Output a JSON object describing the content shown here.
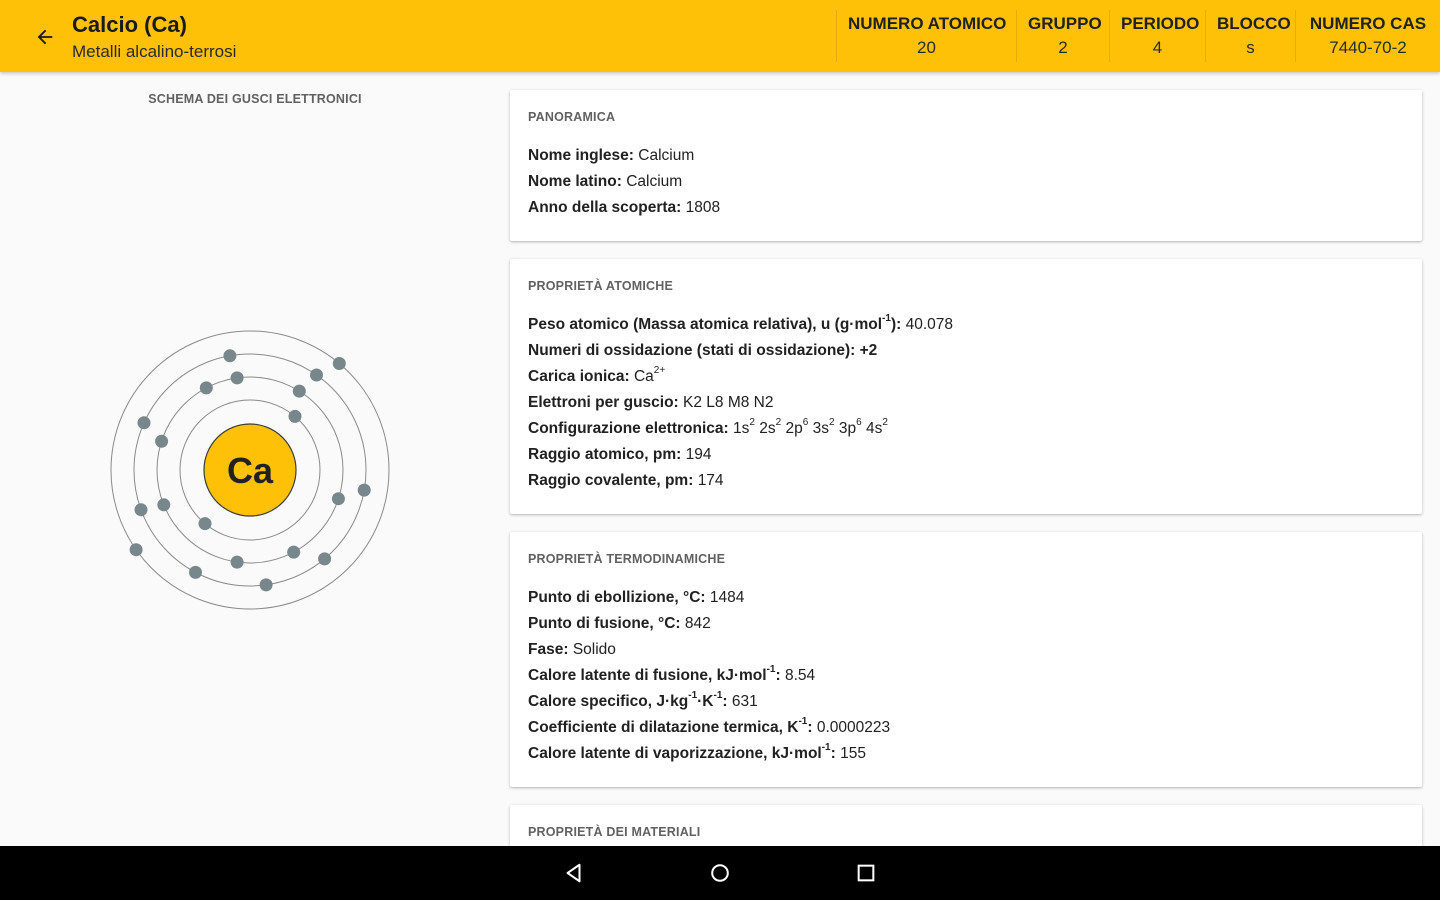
{
  "header": {
    "title": "Calcio (Ca)",
    "subtitle": "Metalli alcalino-terrosi",
    "stats": [
      {
        "label": "NUMERO ATOMICO",
        "value": "20"
      },
      {
        "label": "GRUPPO",
        "value": "2"
      },
      {
        "label": "PERIODO",
        "value": "4"
      },
      {
        "label": "BLOCCO",
        "value": "s"
      },
      {
        "label": "NUMERO CAS",
        "value": "7440-70-2"
      }
    ]
  },
  "shell_diagram": {
    "heading": "SCHEMA DEI GUSCI ELETTRONICI",
    "symbol": "Ca",
    "core_color": "#ffc107",
    "electron_color": "#78878c"
  },
  "overview": {
    "title": "PANORAMICA",
    "english_name_label": "Nome inglese:",
    "english_name": "Calcium",
    "latin_name_label": "Nome latino:",
    "latin_name": "Calcium",
    "discovery_label": "Anno della scoperta:",
    "discovery": "1808"
  },
  "atomic": {
    "title": "PROPRIETÀ ATOMICHE",
    "weight_label": "Peso atomico (Massa atomica relativa), u (g·mol",
    "weight_unit_sup": "-1",
    "weight_label_end": "):",
    "weight": "40.078",
    "oxidation_label": "Numeri di ossidazione (stati di ossidazione):",
    "oxidation": "+2",
    "ionic_label": "Carica ionica:",
    "ionic": "Ca",
    "ionic_sup": "2+",
    "shells_label": "Elettroni per guscio:",
    "shells": "K2 L8 M8 N2",
    "config_label": "Configurazione elettronica:",
    "config": [
      {
        "orb": "1s",
        "n": "2"
      },
      {
        "orb": "2s",
        "n": "2"
      },
      {
        "orb": "2p",
        "n": "6"
      },
      {
        "orb": "3s",
        "n": "2"
      },
      {
        "orb": "3p",
        "n": "6"
      },
      {
        "orb": "4s",
        "n": "2"
      }
    ],
    "radius_label": "Raggio atomico, pm:",
    "radius": "194",
    "covalent_label": "Raggio covalente, pm:",
    "covalent": "174"
  },
  "thermo": {
    "title": "PROPRIETÀ TERMODINAMICHE",
    "boiling_label": "Punto di ebollizione, °C:",
    "boiling": "1484",
    "melting_label": "Punto di fusione, °C:",
    "melting": "842",
    "phase_label": "Fase:",
    "phase": "Solido",
    "fusion_label": "Calore latente di fusione, kJ·mol",
    "fusion_sup": "-1",
    "fusion": "8.54",
    "specific_label_a": "Calore specifico, J·kg",
    "specific_sup_a": "-1",
    "specific_label_b": "·K",
    "specific_sup_b": "-1",
    "specific": "631",
    "expansion_label": "Coefficiente di dilatazione termica, K",
    "expansion_sup": "-1",
    "expansion": "0.0000223",
    "vapor_label": "Calore latente di vaporizzazione, kJ·mol",
    "vapor_sup": "-1",
    "vapor": "155"
  },
  "materials": {
    "title": "PROPRIETÀ DEI MATERIALI"
  },
  "navbar": {
    "icons": [
      "back-triangle-icon",
      "home-circle-icon",
      "recents-square-icon"
    ]
  }
}
